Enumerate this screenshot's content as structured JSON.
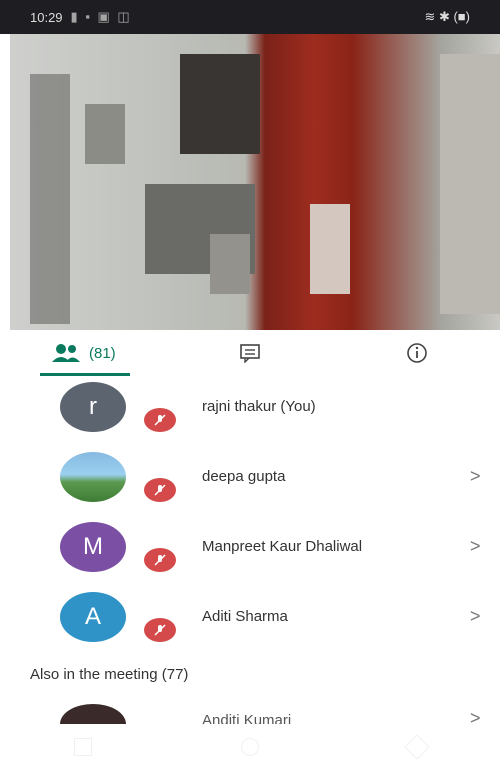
{
  "status_bar": {
    "time": "10:29",
    "right": "≋ ✱ (■)"
  },
  "tabs": {
    "people_count": "(81)"
  },
  "participants": [
    {
      "initial": "r",
      "name": "rajni thakur (You)",
      "color": "#5c6470",
      "photo": false,
      "chevron": false
    },
    {
      "initial": "",
      "name": "deepa gupta",
      "color": "#6aa0c8",
      "photo": true,
      "chevron": true
    },
    {
      "initial": "M",
      "name": "Manpreet Kaur Dhaliwal",
      "color": "#7b4fa3",
      "photo": false,
      "chevron": true
    },
    {
      "initial": "A",
      "name": "Aditi Sharma",
      "color": "#2f93c7",
      "photo": false,
      "chevron": true
    }
  ],
  "also_in_meeting": "Also in the meeting (77)",
  "partial_participant": {
    "name": "Anditi Kumari"
  },
  "colors": {
    "accent": "#0a7a5e",
    "mute": "#d44a4a"
  },
  "icons": {
    "people": "people-icon",
    "chat": "chat-icon",
    "info": "info-icon",
    "mic_off": "mic-off-icon",
    "chevron": "chevron-right-icon"
  }
}
